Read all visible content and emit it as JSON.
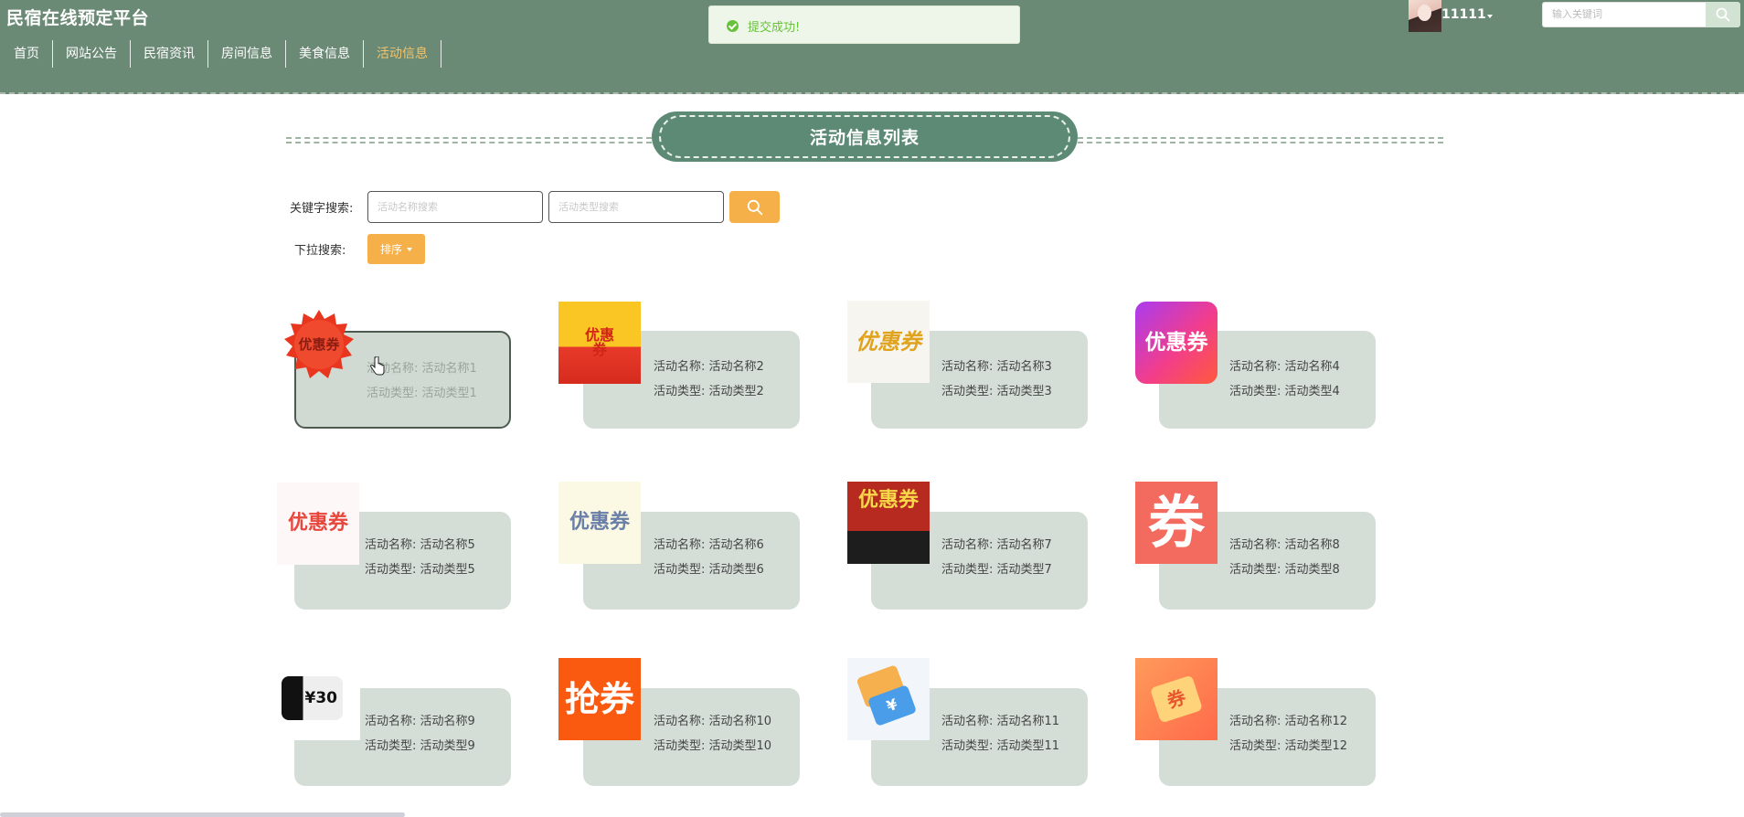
{
  "header": {
    "site_title": "民宿在线预定平台",
    "nav": [
      {
        "label": "首页"
      },
      {
        "label": "网站公告"
      },
      {
        "label": "民宿资讯"
      },
      {
        "label": "房间信息"
      },
      {
        "label": "美食信息"
      },
      {
        "label": "活动信息",
        "active": true
      }
    ],
    "username": "11111",
    "search_placeholder": "输入关键词",
    "bg_color": "#6b8a75",
    "active_nav_color": "#f4c36a"
  },
  "toast": {
    "message": "提交成功!",
    "color": "#67c23a"
  },
  "page": {
    "title": "活动信息列表"
  },
  "search": {
    "keyword_label": "关键字搜索:",
    "name_placeholder": "活动名称搜索",
    "type_placeholder": "活动类型搜索",
    "dropdown_label": "下拉搜索:",
    "sort_label": "排序",
    "accent_color": "#f6b04a"
  },
  "cards": [
    {
      "name_label": "活动名称:",
      "name": "活动名称1",
      "type_label": "活动类型:",
      "type": "活动类型1",
      "image_text": "优惠券"
    },
    {
      "name_label": "活动名称:",
      "name": "活动名称2",
      "type_label": "活动类型:",
      "type": "活动类型2",
      "image_text": "优惠券"
    },
    {
      "name_label": "活动名称:",
      "name": "活动名称3",
      "type_label": "活动类型:",
      "type": "活动类型3",
      "image_text": "优惠券"
    },
    {
      "name_label": "活动名称:",
      "name": "活动名称4",
      "type_label": "活动类型:",
      "type": "活动类型4",
      "image_text": "优惠券"
    },
    {
      "name_label": "活动名称:",
      "name": "活动名称5",
      "type_label": "活动类型:",
      "type": "活动类型5",
      "image_text": "优惠券"
    },
    {
      "name_label": "活动名称:",
      "name": "活动名称6",
      "type_label": "活动类型:",
      "type": "活动类型6",
      "image_text": "优惠券"
    },
    {
      "name_label": "活动名称:",
      "name": "活动名称7",
      "type_label": "活动类型:",
      "type": "活动类型7",
      "image_text": "优惠券"
    },
    {
      "name_label": "活动名称:",
      "name": "活动名称8",
      "type_label": "活动类型:",
      "type": "活动类型8",
      "image_text": "券"
    },
    {
      "name_label": "活动名称:",
      "name": "活动名称9",
      "type_label": "活动类型:",
      "type": "活动类型9",
      "image_text": "¥30"
    },
    {
      "name_label": "活动名称:",
      "name": "活动名称10",
      "type_label": "活动类型:",
      "type": "活动类型10",
      "image_text": "抢券"
    },
    {
      "name_label": "活动名称:",
      "name": "活动名称11",
      "type_label": "活动类型:",
      "type": "活动类型11",
      "image_text": "¥"
    },
    {
      "name_label": "活动名称:",
      "name": "活动名称12",
      "type_label": "活动类型:",
      "type": "活动类型12",
      "image_text": "券"
    }
  ]
}
